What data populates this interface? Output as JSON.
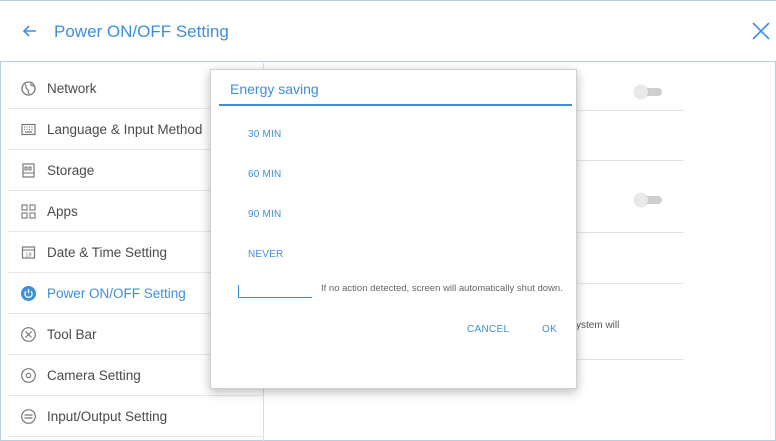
{
  "header": {
    "title": "Power ON/OFF Setting"
  },
  "sidebar": {
    "items": [
      {
        "label": "Network",
        "icon": "globe-icon"
      },
      {
        "label": "Language & Input Method",
        "icon": "keyboard-icon"
      },
      {
        "label": "Storage",
        "icon": "storage-icon"
      },
      {
        "label": "Apps",
        "icon": "apps-grid-icon"
      },
      {
        "label": "Date & Time Setting",
        "icon": "calendar-icon"
      },
      {
        "label": "Power ON/OFF Setting",
        "icon": "power-icon",
        "active": true
      },
      {
        "label": "Tool Bar",
        "icon": "toolbar-icon"
      },
      {
        "label": "Camera Setting",
        "icon": "camera-icon"
      },
      {
        "label": "Input/Output Setting",
        "icon": "input-output-icon"
      }
    ]
  },
  "right_panel": {
    "toggles": [
      {
        "state": "off"
      },
      {
        "state": "off"
      }
    ],
    "peek_text": "ystem will"
  },
  "dialog": {
    "title": "Energy saving",
    "options": [
      "30 MIN",
      "60 MIN",
      "90 MIN",
      "NEVER"
    ],
    "custom_input_value": "",
    "hint": "If no action detected, screen will automatically shut down.",
    "cancel_label": "CANCEL",
    "ok_label": "OK"
  },
  "colors": {
    "accent": "#3d8edb",
    "text": "#4a4a4a",
    "divider": "#e6e6e6",
    "toggle_off": "#cfcfcf"
  }
}
